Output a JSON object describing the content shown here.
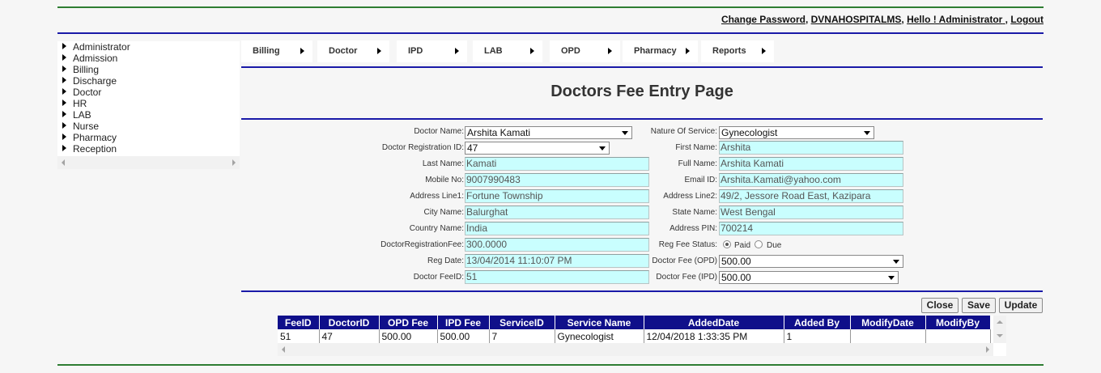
{
  "header": {
    "change_password": "Change Password",
    "app_name": "DVNAHOSPITALMS",
    "greeting": "Hello ! Administrator",
    "logout": "Logout"
  },
  "sidebar": {
    "items": [
      {
        "label": "Administrator"
      },
      {
        "label": "Admission"
      },
      {
        "label": "Billing"
      },
      {
        "label": "Discharge"
      },
      {
        "label": "Doctor"
      },
      {
        "label": "HR"
      },
      {
        "label": "LAB"
      },
      {
        "label": "Nurse"
      },
      {
        "label": "Pharmacy"
      },
      {
        "label": "Reception"
      }
    ]
  },
  "topnav": {
    "items": [
      {
        "label": "Billing"
      },
      {
        "label": "Doctor"
      },
      {
        "label": "IPD"
      },
      {
        "label": "LAB"
      },
      {
        "label": "OPD"
      },
      {
        "label": "Pharmacy"
      },
      {
        "label": "Reports"
      }
    ]
  },
  "page": {
    "title": "Doctors Fee Entry Page"
  },
  "form": {
    "doctor_name": {
      "label": "Doctor Name:",
      "value": "Arshita Kamati"
    },
    "nature_of_service": {
      "label": "Nature Of Service:",
      "value": "Gynecologist"
    },
    "doctor_registration_id": {
      "label": "Doctor Registration ID:",
      "value": "47"
    },
    "first_name": {
      "label": "First Name:",
      "value": "Arshita"
    },
    "last_name": {
      "label": "Last Name:",
      "value": "Kamati"
    },
    "full_name": {
      "label": "Full Name:",
      "value": "Arshita Kamati"
    },
    "mobile_no": {
      "label": "Mobile No:",
      "value": "9007990483"
    },
    "email_id": {
      "label": "Email ID:",
      "value": "Arshita.Kamati@yahoo.com"
    },
    "address_line1": {
      "label": "Address Line1:",
      "value": "Fortune Township"
    },
    "address_line2": {
      "label": "Address Line2:",
      "value": "49/2, Jessore Road East, Kazipara"
    },
    "city_name": {
      "label": "City Name:",
      "value": "Balurghat"
    },
    "state_name": {
      "label": "State Name:",
      "value": "West Bengal"
    },
    "country_name": {
      "label": "Country Name:",
      "value": "India"
    },
    "address_pin": {
      "label": "Address PIN:",
      "value": "700214"
    },
    "doctor_registration_fee": {
      "label": "DoctorRegistrationFee:",
      "value": "300.0000"
    },
    "reg_fee_status": {
      "label": "Reg Fee Status:",
      "options": [
        "Paid",
        "Due"
      ],
      "selected": "Paid"
    },
    "reg_date": {
      "label": "Reg Date:",
      "value": "13/04/2014 11:10:07 PM"
    },
    "doctor_fee_opd": {
      "label": "Doctor Fee (OPD)",
      "value": "500.00"
    },
    "doctor_fee_id": {
      "label": "Doctor FeeID:",
      "value": "51"
    },
    "doctor_fee_ipd": {
      "label": "Doctor Fee (IPD)",
      "value": "500.00"
    }
  },
  "buttons": {
    "close": "Close",
    "save": "Save",
    "update": "Update"
  },
  "grid": {
    "columns": [
      "FeeID",
      "DoctorID",
      "OPD Fee",
      "IPD Fee",
      "ServiceID",
      "Service Name",
      "AddedDate",
      "Added By",
      "ModifyDate",
      "ModifyBy"
    ],
    "rows": [
      [
        "51",
        "47",
        "500.00",
        "500.00",
        "7",
        "Gynecologist",
        "12/04/2018 1:33:35 PM",
        "1",
        "",
        ""
      ]
    ]
  }
}
